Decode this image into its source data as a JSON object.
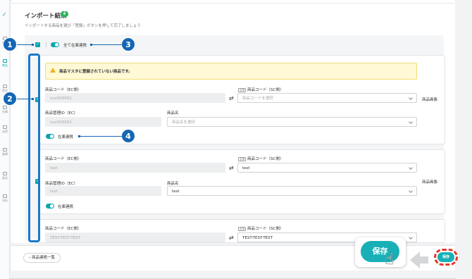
{
  "sidebar": {
    "items": [
      {
        "label": "商品",
        "active": false
      },
      {
        "label": "商品",
        "active": true
      },
      {
        "label": "受注",
        "active": false
      },
      {
        "label": "在庫",
        "active": false
      },
      {
        "label": "出荷",
        "active": false
      },
      {
        "label": "倉庫",
        "active": false
      },
      {
        "label": "設定",
        "active": false
      },
      {
        "label": "分析",
        "active": false
      }
    ]
  },
  "header": {
    "title": "インポート結果",
    "count": "4",
    "subtitle": "インポートする商品を選び「登録」ボタンを押して完了しましょう"
  },
  "all_sync": {
    "label": "全て在庫連携"
  },
  "cards": [
    {
      "warning": "商品マスタに登録されていない商品です。",
      "ec_code_label": "商品コード（EC側）",
      "ec_code_value": "xxx000001",
      "sc_code_label": "商品コード（SC側）",
      "sc_code_placeholder": "商品コードを選択",
      "mgmt_label": "商品管理ID（EC）",
      "mgmt_value": "xxx000001",
      "name_label": "商品名",
      "name_placeholder": "商品名を選択",
      "sync_label": "在庫連携",
      "image_label": "商品画像"
    },
    {
      "ec_code_label": "商品コード（EC側）",
      "ec_code_value": "test",
      "sc_code_label": "商品コード（SC側）",
      "sc_code_value": "test",
      "mgmt_label": "商品管理ID（EC）",
      "mgmt_value": "test",
      "name_label": "商品名",
      "name_value": "test",
      "sync_label": "在庫連携",
      "image_label": "商品画像"
    },
    {
      "ec_code_label": "商品コード（EC側）",
      "ec_code_value": "TEST-TEST-TEST",
      "sc_code_label": "商品コード（SC側）",
      "sc_code_value": "TEST-TEST-TEST"
    }
  ],
  "sc_tag": "必須",
  "callouts": [
    "1",
    "2",
    "3",
    "4"
  ],
  "footer": {
    "back_label": "商品連携一覧",
    "save_label": "保存"
  },
  "colors": {
    "accent": "#18b0b6",
    "callout": "#1567b4",
    "highlight": "#e8362b",
    "warning_bg": "#fff9d6"
  }
}
